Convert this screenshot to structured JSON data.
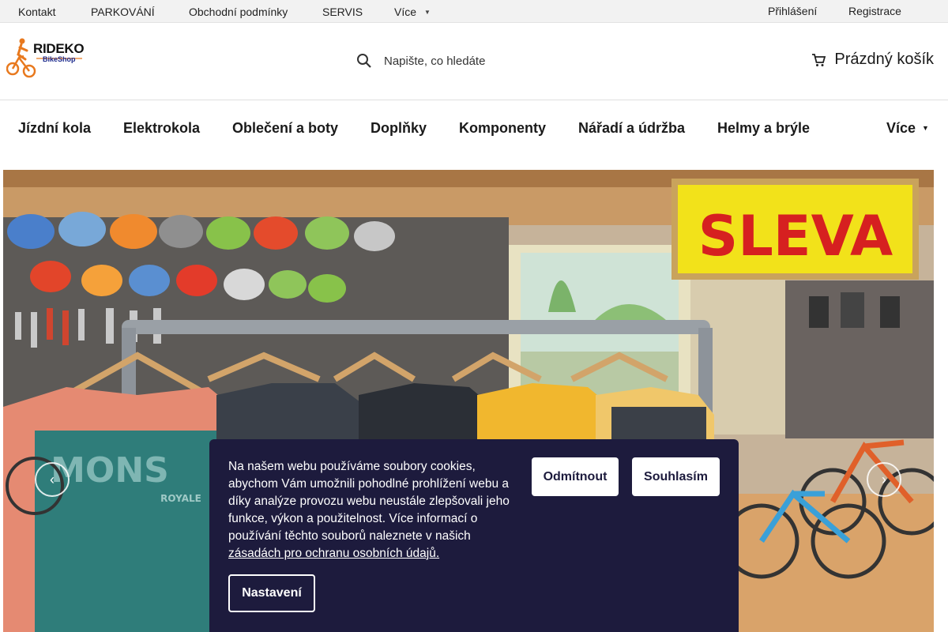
{
  "topbar": {
    "links": [
      "Kontakt",
      "PARKOVÁNÍ",
      "Obchodní podmínky",
      "SERVIS",
      "Více"
    ],
    "login": "Přihlášení",
    "register": "Registrace"
  },
  "header": {
    "logo_text": "RIDEKO",
    "logo_sub": "BikeShop",
    "search_placeholder": "Napište, co hledáte",
    "cart_label": "Prázdný košík"
  },
  "nav": {
    "categories": [
      "Jízdní kola",
      "Elektrokola",
      "Oblečení a boty",
      "Doplňky",
      "Komponenty",
      "Nářadí a údržba",
      "Helmy a brýle"
    ],
    "more": "Více"
  },
  "hero": {
    "sign_text": "SLEVA",
    "shirt_brand": "MONS",
    "shirt_sub": "ROYALE"
  },
  "cookie": {
    "text": "Na našem webu používáme soubory cookies, abychom Vám umožnili pohodlné prohlížení webu a díky analýze provozu webu neustále zlepšovali jeho funkce, výkon a použitelnost. Více informací o používání těchto souborů naleznete v našich",
    "link": "zásadách pro ochranu osobních údajů.",
    "reject": "Odmítnout",
    "accept": "Souhlasím",
    "settings": "Nastavení"
  },
  "icons": {
    "search": "search-icon",
    "cart": "cart-icon",
    "prev": "chevron-left-icon",
    "next": "chevron-right-icon"
  },
  "colors": {
    "banner_bg": "#1d1b3d",
    "sign_yellow": "#f2e21a",
    "sign_red": "#d62020"
  }
}
